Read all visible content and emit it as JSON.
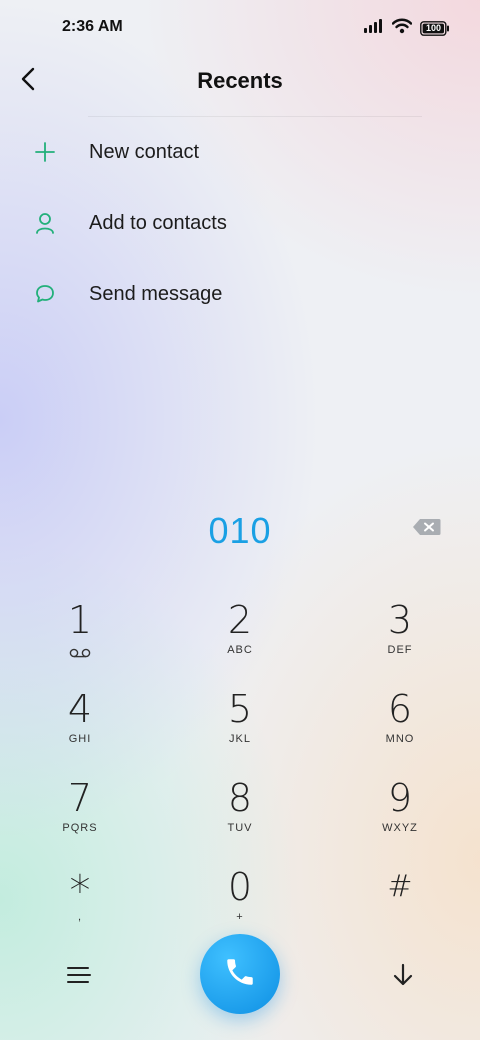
{
  "status_bar": {
    "time": "2:36 AM",
    "battery": "100",
    "icons": [
      "signal-icon",
      "wifi-icon",
      "battery-icon"
    ]
  },
  "header": {
    "title": "Recents",
    "back_icon": "back-arrow-icon"
  },
  "actions": [
    {
      "label": "New contact",
      "icon": "plus-icon"
    },
    {
      "label": "Add to contacts",
      "icon": "person-icon"
    },
    {
      "label": "Send message",
      "icon": "message-bubble-icon"
    }
  ],
  "dialer": {
    "number": "010",
    "backspace_icon": "backspace-icon"
  },
  "keypad": [
    {
      "digit": "1",
      "letters": "",
      "sub_icon": "voicemail-icon"
    },
    {
      "digit": "2",
      "letters": "ABC"
    },
    {
      "digit": "3",
      "letters": "DEF"
    },
    {
      "digit": "4",
      "letters": "GHI"
    },
    {
      "digit": "5",
      "letters": "JKL"
    },
    {
      "digit": "6",
      "letters": "MNO"
    },
    {
      "digit": "7",
      "letters": "PQRS"
    },
    {
      "digit": "8",
      "letters": "TUV"
    },
    {
      "digit": "9",
      "letters": "WXYZ"
    },
    {
      "digit": "*",
      "letters": ","
    },
    {
      "digit": "0",
      "letters": "+"
    },
    {
      "digit": "#",
      "letters": ""
    }
  ],
  "bottom_bar": {
    "menu_icon": "menu-icon",
    "call_icon": "phone-icon",
    "collapse_icon": "arrow-down-icon"
  },
  "colors": {
    "accent": "#1aa0e4",
    "action_icon": "#22b07a",
    "call_button": "#1aa0e4"
  }
}
